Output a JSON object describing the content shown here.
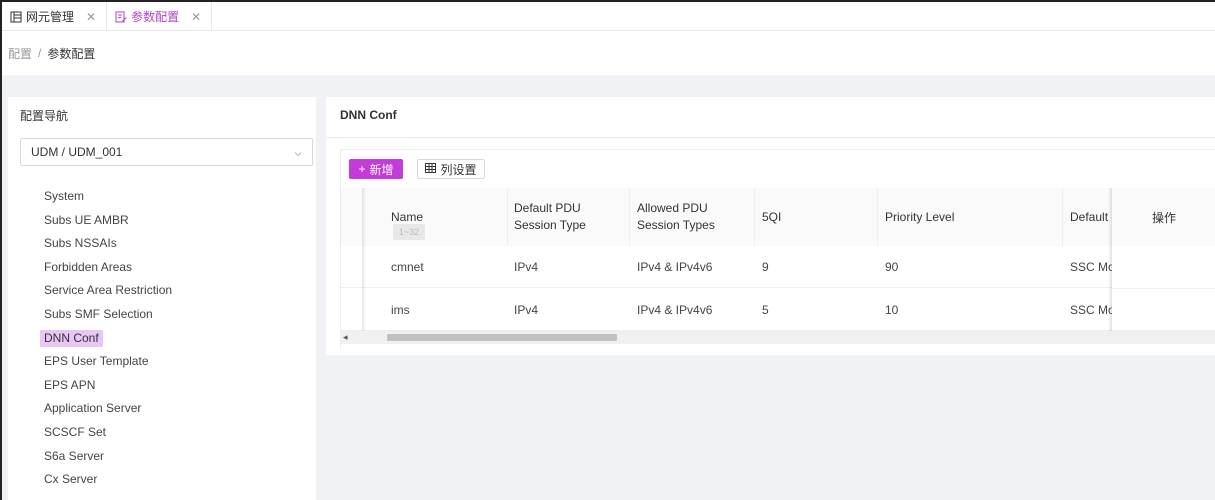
{
  "tabs": [
    {
      "label": "网元管理",
      "close": "✕",
      "active": false
    },
    {
      "label": "参数配置",
      "close": "✕",
      "active": true
    }
  ],
  "breadcrumb": {
    "parent": "配置",
    "separator": "/",
    "current": "参数配置"
  },
  "nav": {
    "title": "配置导航",
    "selector_value": "UDM / UDM_001",
    "items": [
      {
        "label": "System",
        "active": false
      },
      {
        "label": "Subs UE AMBR",
        "active": false
      },
      {
        "label": "Subs NSSAIs",
        "active": false
      },
      {
        "label": "Forbidden Areas",
        "active": false
      },
      {
        "label": "Service Area Restriction",
        "active": false
      },
      {
        "label": "Subs SMF Selection",
        "active": false
      },
      {
        "label": "DNN Conf",
        "active": true
      },
      {
        "label": "EPS User Template",
        "active": false
      },
      {
        "label": "EPS APN",
        "active": false
      },
      {
        "label": "Application Server",
        "active": false
      },
      {
        "label": "SCSCF Set",
        "active": false
      },
      {
        "label": "S6a Server",
        "active": false
      },
      {
        "label": "Cx Server",
        "active": false
      }
    ]
  },
  "main": {
    "title": "DNN Conf",
    "add_button": {
      "icon": "+",
      "label": "新增"
    },
    "columns_button": {
      "label": "列设置"
    },
    "tooltip": "1~32",
    "table": {
      "headers": [
        "Name",
        "Default PDU Session Type",
        "Allowed PDU Session Types",
        "5QI",
        "Priority Level",
        "Default S",
        "操作"
      ],
      "header_lines": {
        "default_pdu": [
          "Default PDU",
          "Session Type"
        ],
        "allowed_pdu": [
          "Allowed PDU",
          "Session Types"
        ]
      },
      "rows": [
        {
          "name": "cmnet",
          "default_pdu": "IPv4",
          "allowed_pdu": "IPv4 & IPv4v6",
          "fiveqi": "9",
          "priority": "90",
          "default_s": "SSC Mo",
          "op": ""
        },
        {
          "name": "ims",
          "default_pdu": "IPv4",
          "allowed_pdu": "IPv4 & IPv4v6",
          "fiveqi": "5",
          "priority": "10",
          "default_s": "SSC Mo",
          "op": ""
        }
      ]
    },
    "scroll_left_arrow": "◂"
  },
  "colors": {
    "accent": "#c43bd9",
    "active_nav_bg": "#e9c6f5",
    "page_bg": "#f0f2f5"
  },
  "icons": {
    "tab1": "server-icon",
    "tab2": "config-edit-icon",
    "columns": "grid-icon",
    "select": "chevron-down-icon"
  }
}
